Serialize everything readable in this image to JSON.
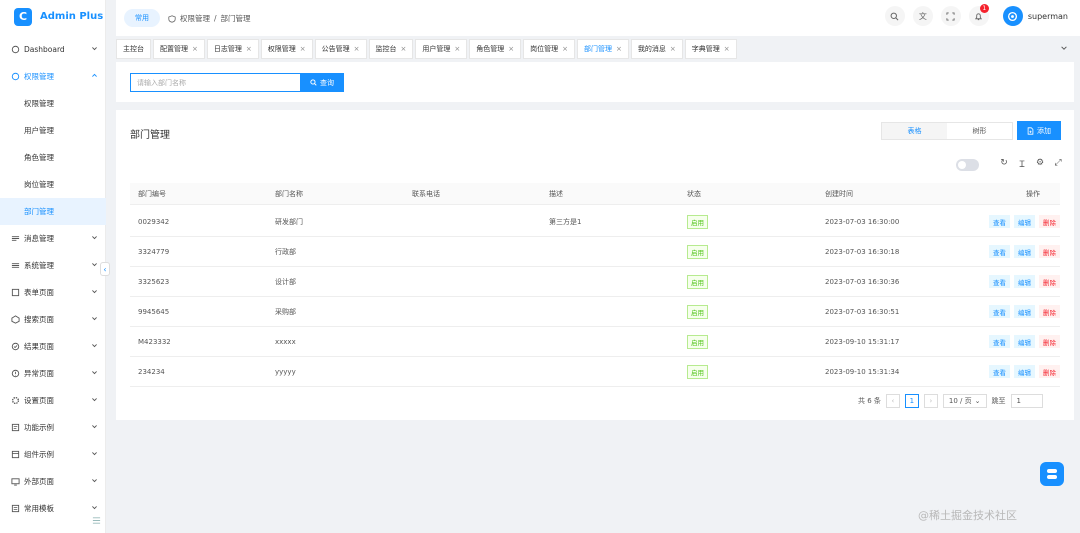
{
  "app": {
    "title": "Admin Plus",
    "logo_letter": "C"
  },
  "sidebar": {
    "items": [
      {
        "label": "Dashboard",
        "icon": "dashboard-icon"
      },
      {
        "label": "权限管理",
        "icon": "lock-icon",
        "open": true,
        "children": [
          {
            "label": "权限管理"
          },
          {
            "label": "用户管理"
          },
          {
            "label": "角色管理"
          },
          {
            "label": "岗位管理"
          },
          {
            "label": "部门管理",
            "active": true
          }
        ]
      },
      {
        "label": "消息管理",
        "icon": "message-icon"
      },
      {
        "label": "系统管理",
        "icon": "system-icon"
      },
      {
        "label": "表单页面",
        "icon": "form-icon"
      },
      {
        "label": "搜索页面",
        "icon": "search-page-icon"
      },
      {
        "label": "结果页面",
        "icon": "result-icon"
      },
      {
        "label": "异常页面",
        "icon": "exception-icon"
      },
      {
        "label": "设置页面",
        "icon": "settings-icon"
      },
      {
        "label": "功能示例",
        "icon": "feature-icon"
      },
      {
        "label": "组件示例",
        "icon": "component-icon"
      },
      {
        "label": "外部页面",
        "icon": "external-icon"
      },
      {
        "label": "常用模板",
        "icon": "template-icon"
      }
    ]
  },
  "header": {
    "home": "常用",
    "breadcrumb": [
      "权限管理",
      "部门管理"
    ],
    "username": "superman",
    "notify_count": "1"
  },
  "tabs": [
    {
      "label": "主控台",
      "closable": false
    },
    {
      "label": "配置管理"
    },
    {
      "label": "日志管理"
    },
    {
      "label": "权限管理"
    },
    {
      "label": "公告管理"
    },
    {
      "label": "监控台"
    },
    {
      "label": "用户管理"
    },
    {
      "label": "角色管理"
    },
    {
      "label": "岗位管理"
    },
    {
      "label": "部门管理",
      "active": true
    },
    {
      "label": "我的消息"
    },
    {
      "label": "字典管理"
    }
  ],
  "search": {
    "placeholder": "请输入部门名称",
    "button": "查询"
  },
  "page": {
    "title": "部门管理",
    "view_table": "表格",
    "view_tree": "树形",
    "add": "添加"
  },
  "table": {
    "columns": [
      "部门编号",
      "部门名称",
      "联系电话",
      "描述",
      "状态",
      "创建时间",
      "操作"
    ],
    "rows": [
      {
        "id": "0029342",
        "name": "研发部门",
        "phone": "",
        "desc": "第三方是1",
        "status": "启用",
        "created": "2023-07-03 16:30:00"
      },
      {
        "id": "3324779",
        "name": "行政部",
        "phone": "",
        "desc": "",
        "status": "启用",
        "created": "2023-07-03 16:30:18"
      },
      {
        "id": "3325623",
        "name": "设计部",
        "phone": "",
        "desc": "",
        "status": "启用",
        "created": "2023-07-03 16:30:36"
      },
      {
        "id": "9945645",
        "name": "采购部",
        "phone": "",
        "desc": "",
        "status": "启用",
        "created": "2023-07-03 16:30:51"
      },
      {
        "id": "M423332",
        "name": "xxxxx",
        "phone": "",
        "desc": "",
        "status": "启用",
        "created": "2023-09-10 15:31:17"
      },
      {
        "id": "234234",
        "name": "yyyyy",
        "phone": "",
        "desc": "",
        "status": "启用",
        "created": "2023-09-10 15:31:34"
      }
    ],
    "actions": {
      "view": "查看",
      "edit": "编辑",
      "delete": "删除"
    }
  },
  "pagination": {
    "total": "共 6 条",
    "current": "1",
    "size": "10 / 页",
    "jump_label": "跳至",
    "jump_value": "1"
  },
  "watermark": "@稀土掘金技术社区"
}
